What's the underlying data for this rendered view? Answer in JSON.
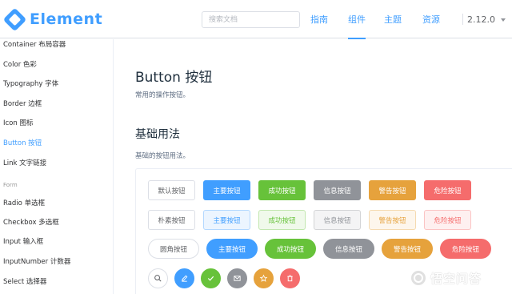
{
  "header": {
    "logo_text": "Element",
    "search_placeholder": "搜索文档",
    "nav": [
      {
        "label": "指南",
        "active": false
      },
      {
        "label": "组件",
        "active": true
      },
      {
        "label": "主题",
        "active": false
      },
      {
        "label": "资源",
        "active": false
      }
    ],
    "version": "2.12.0"
  },
  "sidebar": {
    "items": [
      {
        "label": "Container 布局容器",
        "active": false
      },
      {
        "label": "Color 色彩",
        "active": false
      },
      {
        "label": "Typography 字体",
        "active": false
      },
      {
        "label": "Border 边框",
        "active": false
      },
      {
        "label": "Icon 图标",
        "active": false
      },
      {
        "label": "Button 按钮",
        "active": true
      },
      {
        "label": "Link 文字链接",
        "active": false
      }
    ],
    "group_label": "Form",
    "form_items": [
      {
        "label": "Radio 单选框"
      },
      {
        "label": "Checkbox 多选框"
      },
      {
        "label": "Input 输入框"
      },
      {
        "label": "InputNumber 计数器"
      },
      {
        "label": "Select 选择器"
      }
    ]
  },
  "main": {
    "title": "Button 按钮",
    "description": "常用的操作按钮。",
    "section_title": "基础用法",
    "section_description": "基础的按钮用法。"
  },
  "colors": {
    "primary": "#409eff",
    "success": "#67c23a",
    "info": "#909399",
    "warning": "#e6a23c",
    "danger": "#f56c6c"
  },
  "buttons": {
    "labels": [
      "默认按钮",
      "主要按钮",
      "成功按钮",
      "信息按钮",
      "警告按钮",
      "危险按钮"
    ],
    "plain_labels": [
      "朴素按钮",
      "主要按钮",
      "成功按钮",
      "信息按钮",
      "警告按钮",
      "危险按钮"
    ],
    "round_labels": [
      "圆角按钮",
      "主要按钮",
      "成功按钮",
      "信息按钮",
      "警告按钮",
      "危险按钮"
    ],
    "circle_icons": [
      "search-icon",
      "edit-icon",
      "check-icon",
      "message-icon",
      "star-icon",
      "delete-icon"
    ]
  },
  "watermark": {
    "text": "悟空问答"
  }
}
